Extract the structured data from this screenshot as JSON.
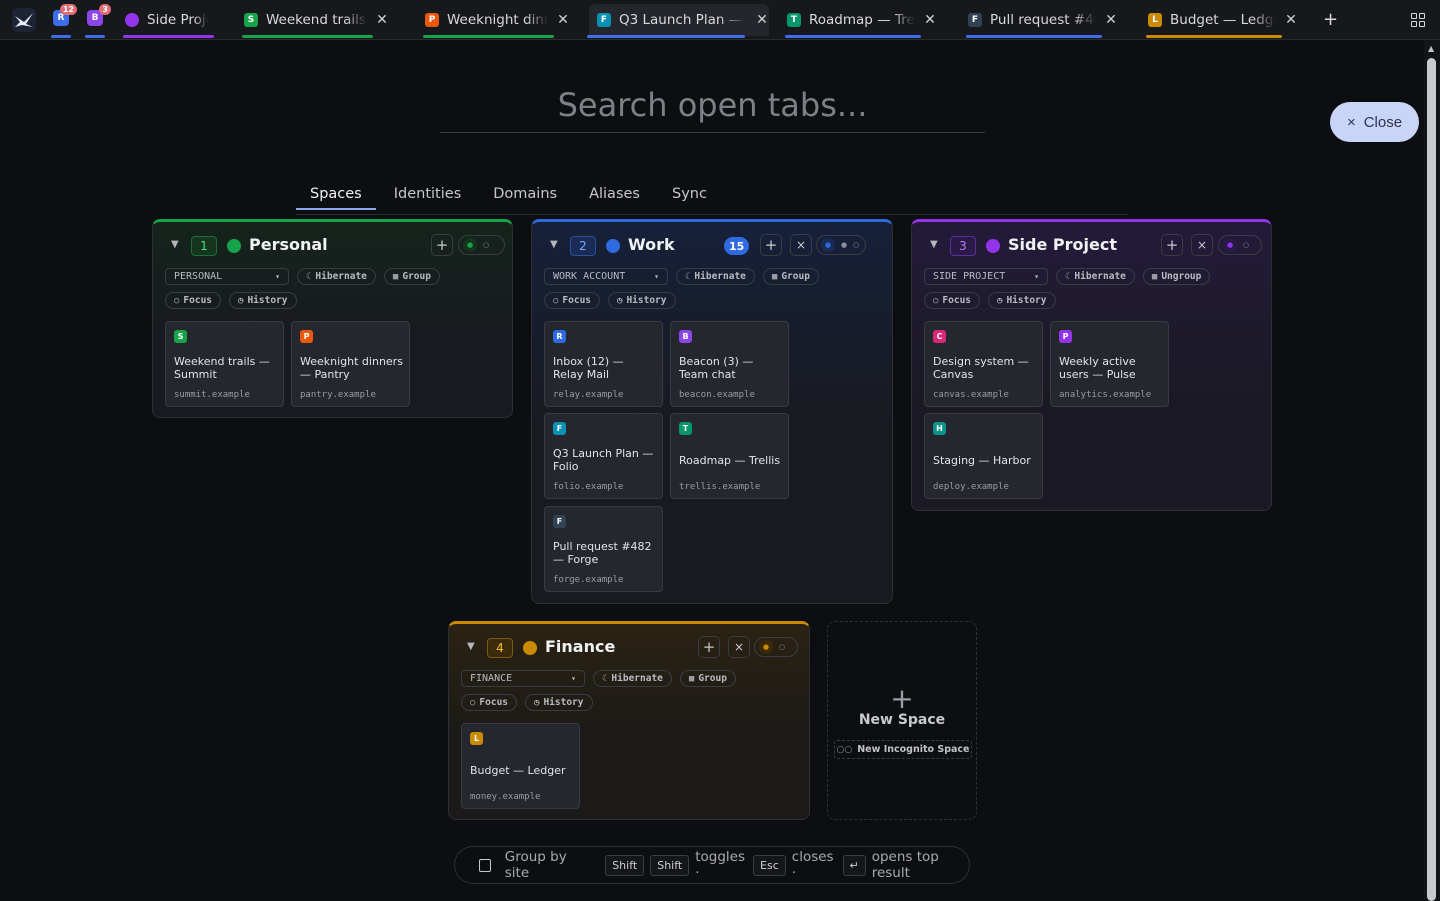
{
  "tabbar": {
    "pinned": [
      {
        "letter": "R",
        "badge": "12",
        "color": "#3b6ee8",
        "underline": "#3b6ee8"
      },
      {
        "letter": "B",
        "badge": "3",
        "color": "#8b45e8",
        "underline": "#3b6ee8"
      }
    ],
    "tabs": [
      {
        "title": "Side Project",
        "favicon": "dot",
        "color": "#9333ea",
        "underline": "#9333ea"
      },
      {
        "title": "Weekend trails — Summit",
        "favicon": "S",
        "color": "#16a34a",
        "underline": "#16a34a"
      },
      {
        "title": "Weeknight dinners — Pantry",
        "favicon": "P",
        "color": "#ea580c",
        "underline": "#16a34a"
      },
      {
        "title": "Q3 Launch Plan — Folio",
        "favicon": "F",
        "color": "#0891b2",
        "underline": "#3b6ee8"
      },
      {
        "title": "Roadmap — Trellis",
        "favicon": "T",
        "color": "#059669",
        "underline": "#3b6ee8"
      },
      {
        "title": "Pull request #482 — Forge",
        "favicon": "F",
        "color": "#334155",
        "underline": "#3b6ee8"
      },
      {
        "title": "Budget — Ledger",
        "favicon": "L",
        "color": "#ca8a04",
        "underline": "#ca8a04"
      }
    ],
    "new_tab": "+",
    "grid_icon": "grid-icon"
  },
  "search": {
    "placeholder": "Search open tabs..."
  },
  "close_button": {
    "icon": "×",
    "label": "Close"
  },
  "nav_tabs": [
    "Spaces",
    "Identities",
    "Domains",
    "Aliases",
    "Sync"
  ],
  "spaces": [
    {
      "number": "1",
      "name": "Personal",
      "color": "#16a34a",
      "account": "PERSONAL",
      "count": "",
      "chips": [
        "Hibernate",
        "Group",
        "Focus",
        "History"
      ],
      "tabs": [
        {
          "favicon": "S",
          "color": "#16a34a",
          "title": "Weekend trails — Summit",
          "domain": "summit.example"
        },
        {
          "favicon": "P",
          "color": "#ea580c",
          "title": "Weeknight dinners — Pantry",
          "domain": "pantry.example"
        }
      ]
    },
    {
      "number": "2",
      "name": "Work",
      "color": "#2f6be0",
      "account": "WORK ACCOUNT",
      "count": "15",
      "chips": [
        "Hibernate",
        "Group",
        "Focus",
        "History"
      ],
      "tabs": [
        {
          "favicon": "R",
          "color": "#2f6be0",
          "title": "Inbox (12) — Relay Mail",
          "domain": "relay.example"
        },
        {
          "favicon": "B",
          "color": "#8b45e8",
          "title": "Beacon (3) — Team chat",
          "domain": "beacon.example"
        },
        {
          "favicon": "F",
          "color": "#0891b2",
          "title": "Q3 Launch Plan — Folio",
          "domain": "folio.example"
        },
        {
          "favicon": "T",
          "color": "#059669",
          "title": "Roadmap — Trellis",
          "domain": "trellis.example"
        },
        {
          "favicon": "F",
          "color": "#334155",
          "title": "Pull request #482 — Forge",
          "domain": "forge.example"
        }
      ]
    },
    {
      "number": "3",
      "name": "Side Project",
      "color": "#9333ea",
      "account": "SIDE PROJECT",
      "count": "",
      "chips": [
        "Hibernate",
        "Ungroup",
        "Focus",
        "History"
      ],
      "tabs": [
        {
          "favicon": "C",
          "color": "#db2777",
          "title": "Design system — Canvas",
          "domain": "canvas.example"
        },
        {
          "favicon": "P",
          "color": "#9333ea",
          "title": "Weekly active users — Pulse",
          "domain": "analytics.example"
        },
        {
          "favicon": "H",
          "color": "#0d9488",
          "title": "Staging — Harbor",
          "domain": "deploy.example"
        }
      ]
    },
    {
      "number": "4",
      "name": "Finance",
      "color": "#ca8a04",
      "account": "FINANCE",
      "count": "",
      "chips": [
        "Hibernate",
        "Group",
        "Focus",
        "History"
      ],
      "tabs": [
        {
          "favicon": "L",
          "color": "#ca8a04",
          "title": "Budget — Ledger",
          "domain": "money.example"
        }
      ]
    }
  ],
  "new_space": {
    "icon": "+",
    "label": "New Space",
    "incognito": "New Incognito Space"
  },
  "footer": {
    "group_by_site": "Group by site",
    "key_shift": "Shift",
    "key_shift2": "Shift",
    "toggles": "toggles ·",
    "key_esc": "Esc",
    "closes": "closes ·",
    "key_enter": "↵",
    "opens": "opens top result"
  }
}
